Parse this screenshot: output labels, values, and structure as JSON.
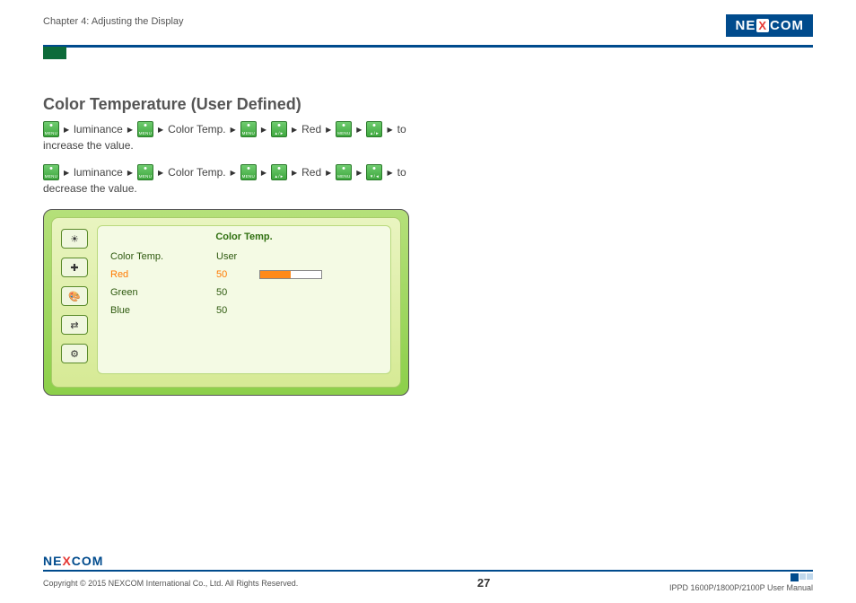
{
  "header": {
    "chapter": "Chapter 4: Adjusting the Display",
    "brand_left": "NE",
    "brand_x": "X",
    "brand_right": "COM"
  },
  "title": "Color Temperature (User Defined)",
  "nav_labels": {
    "menu": "MENU",
    "up": "▲/►",
    "down": "▼/◄"
  },
  "instructions": [
    {
      "seq": [
        {
          "btn": "menu"
        },
        "luminance",
        {
          "btn": "menu"
        },
        "Color Temp.",
        {
          "btn": "menu"
        },
        {
          "btn": "up"
        },
        "Red",
        {
          "btn": "menu"
        },
        {
          "btn": "up"
        },
        "to"
      ],
      "after": "increase the value."
    },
    {
      "seq": [
        {
          "btn": "menu"
        },
        "luminance",
        {
          "btn": "menu"
        },
        "Color Temp.",
        {
          "btn": "menu"
        },
        {
          "btn": "up"
        },
        "Red",
        {
          "btn": "menu"
        },
        {
          "btn": "down"
        },
        "to"
      ],
      "after": "decrease the value."
    }
  ],
  "osd": {
    "title": "Color Temp.",
    "tabs": [
      "brightness",
      "geometry",
      "color",
      "input",
      "setup"
    ],
    "selected_tab": 2,
    "rows": [
      {
        "label": "Color Temp.",
        "value": "User",
        "selected": false,
        "bar": null
      },
      {
        "label": "Red",
        "value": "50",
        "selected": true,
        "bar": 50
      },
      {
        "label": "Green",
        "value": "50",
        "selected": false,
        "bar": null
      },
      {
        "label": "Blue",
        "value": "50",
        "selected": false,
        "bar": null
      }
    ]
  },
  "footer": {
    "brand_left": "NE",
    "brand_x": "X",
    "brand_right": "COM",
    "copyright": "Copyright © 2015 NEXCOM International Co., Ltd. All Rights Reserved.",
    "page": "27",
    "doc": "IPPD 1600P/1800P/2100P User Manual"
  }
}
